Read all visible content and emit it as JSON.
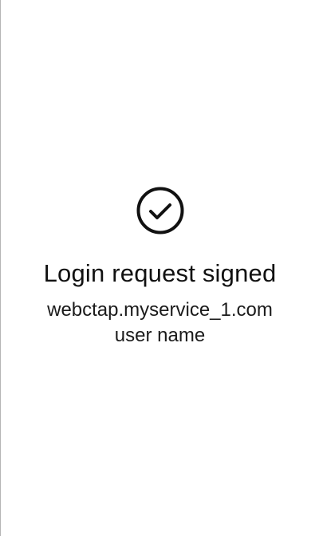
{
  "status": {
    "icon": "check-circle-icon",
    "title": "Login request signed",
    "domain": "webctap.myservice_1.com",
    "user": "user name"
  },
  "colors": {
    "text": "#111111",
    "icon": "#111111",
    "background": "#ffffff",
    "frame_border": "#b5b5b5"
  }
}
